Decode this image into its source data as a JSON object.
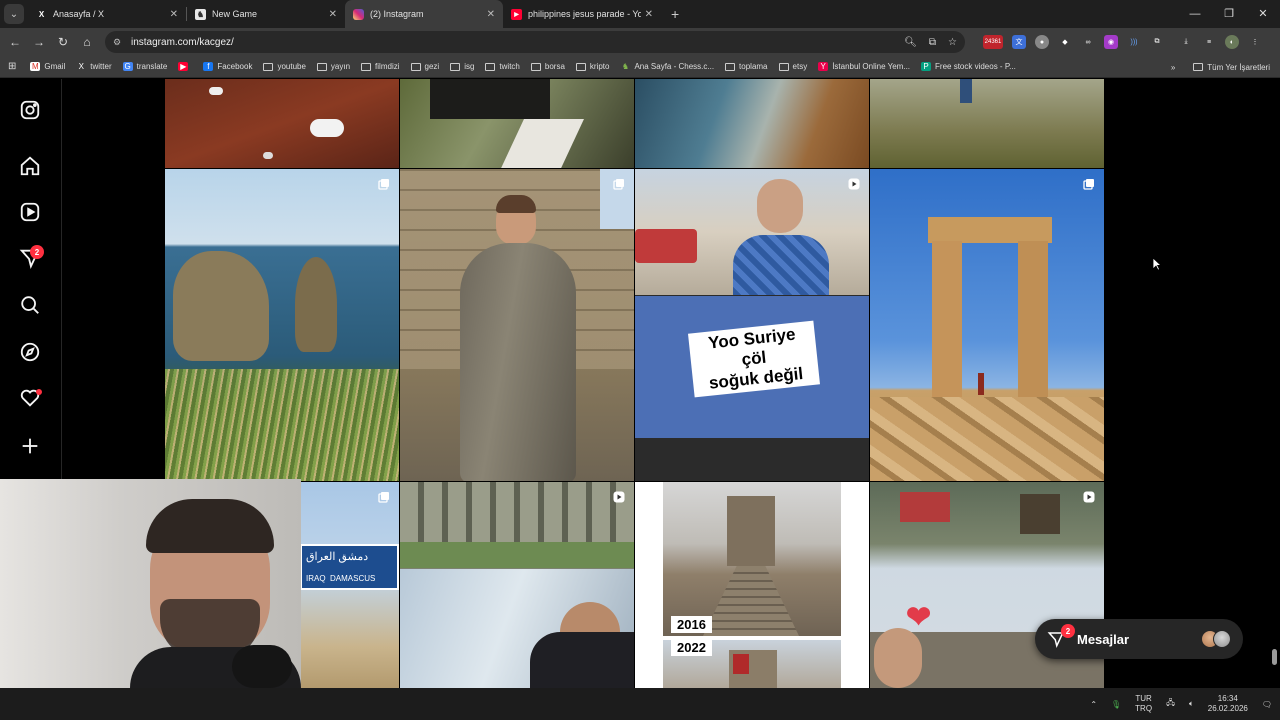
{
  "browser": {
    "tabs": [
      {
        "title": "Anasayfa / X",
        "icon": "x-logo-icon",
        "active": false
      },
      {
        "title": "New Game",
        "icon": "chess-icon",
        "active": false
      },
      {
        "title": "(2) Instagram",
        "icon": "instagram-icon",
        "active": true
      },
      {
        "title": "philippines jesus parade - YouTube",
        "icon": "youtube-icon",
        "active": false
      }
    ],
    "url": "instagram.com/kacgez/",
    "extension_badge": "24361",
    "bookmarks": [
      {
        "label": "Gmail",
        "icon": "gmail-icon"
      },
      {
        "label": "twitter",
        "icon": "x-logo-icon"
      },
      {
        "label": "translate",
        "icon": "translate-icon"
      },
      {
        "label": "",
        "icon": "youtube-icon"
      },
      {
        "label": "Facebook",
        "icon": "facebook-icon"
      },
      {
        "label": "youtube",
        "icon": "folder-icon"
      },
      {
        "label": "yayın",
        "icon": "folder-icon"
      },
      {
        "label": "filmdizi",
        "icon": "folder-icon"
      },
      {
        "label": "gezi",
        "icon": "folder-icon"
      },
      {
        "label": "isg",
        "icon": "folder-icon"
      },
      {
        "label": "twitch",
        "icon": "folder-icon"
      },
      {
        "label": "borsa",
        "icon": "folder-icon"
      },
      {
        "label": "kripto",
        "icon": "folder-icon"
      },
      {
        "label": "Ana Sayfa - Chess.c...",
        "icon": "chess-icon"
      },
      {
        "label": "toplama",
        "icon": "folder-icon"
      },
      {
        "label": "etsy",
        "icon": "folder-icon"
      },
      {
        "label": "İstanbul Online Yem...",
        "icon": "yemeksepeti-icon"
      },
      {
        "label": "Free stock videos - P...",
        "icon": "pexels-icon"
      }
    ],
    "all_bookmarks": "Tüm Yer İşaretleri"
  },
  "instagram": {
    "nav": [
      {
        "name": "instagram-logo-icon"
      },
      {
        "name": "home-icon"
      },
      {
        "name": "reels-icon"
      },
      {
        "name": "messages-icon",
        "badge": "2"
      },
      {
        "name": "search-icon"
      },
      {
        "name": "explore-icon"
      },
      {
        "name": "notifications-icon",
        "dot": true
      },
      {
        "name": "create-icon"
      }
    ],
    "posts": {
      "caption_line1": "Yoo Suriye çöl",
      "caption_line2": "soğuk değil",
      "year_top": "2016",
      "year_bottom": "2022",
      "sign_arabic": "دمشق العراق",
      "sign_iraq": "IRAQ",
      "sign_damascus": "DAMASCUS"
    },
    "messages_pill": {
      "label": "Mesajlar",
      "badge": "2"
    }
  },
  "taskbar": {
    "lang_top": "TUR",
    "lang_bottom": "TRQ",
    "time": "16:34",
    "date": "26.02.2026"
  },
  "colors": {
    "accent_red": "#ff3040",
    "page_bg": "#000000",
    "chrome_bg": "#3c3c3c"
  }
}
